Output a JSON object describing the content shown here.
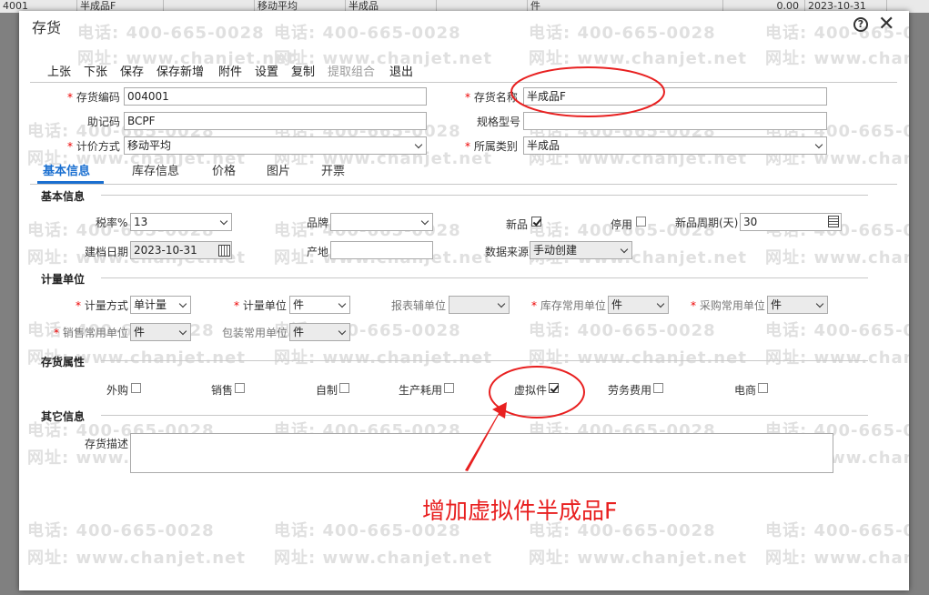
{
  "background_row": {
    "cells": [
      "4001",
      "半成品F",
      "移动平均",
      "半成品",
      "件",
      "0.00",
      "2023-10-31"
    ]
  },
  "dialog": {
    "title": "存货",
    "help_glyph": "?",
    "close_glyph": "✕"
  },
  "watermark": {
    "phone": "电话: 400-665-0028",
    "site": "网址: www.chanjet.net"
  },
  "toolbar": {
    "prev": "上张",
    "next": "下张",
    "save": "保存",
    "save_new": "保存新增",
    "attach": "附件",
    "settings": "设置",
    "copy": "复制",
    "extract_combo": "提取组合",
    "exit": "退出"
  },
  "header_form": {
    "code_label": "存货编码",
    "code_value": "004001",
    "name_label": "存货名称",
    "name_value": "半成品F",
    "mnemonic_label": "助记码",
    "mnemonic_value": "BCPF",
    "spec_label": "规格型号",
    "spec_value": "",
    "pricing_label": "计价方式",
    "pricing_value": "移动平均",
    "category_label": "所属类别",
    "category_value": "半成品"
  },
  "tabs": [
    "基本信息",
    "库存信息",
    "价格",
    "图片",
    "开票"
  ],
  "basic": {
    "section_title": "基本信息",
    "tax_label": "税率%",
    "tax_value": "13",
    "brand_label": "品牌",
    "brand_value": "",
    "new_label": "新品",
    "new_checked": true,
    "disabled_label": "停用",
    "disabled_checked": false,
    "new_period_label": "新品周期(天)",
    "new_period_value": "30",
    "created_label": "建档日期",
    "created_value": "2023-10-31",
    "origin_label": "产地",
    "origin_value": "",
    "source_label": "数据来源",
    "source_value": "手动创建"
  },
  "units": {
    "section_title": "计量单位",
    "method_label": "计量方式",
    "method_value": "单计量",
    "unit_label": "计量单位",
    "unit_value": "件",
    "report_label": "报表辅单位",
    "report_value": "",
    "stock_label": "库存常用单位",
    "stock_value": "件",
    "purchase_label": "采购常用单位",
    "purchase_value": "件",
    "sales_label": "销售常用单位",
    "sales_value": "件",
    "pack_label": "包装常用单位",
    "pack_value": "件"
  },
  "attributes": {
    "section_title": "存货属性",
    "items": [
      {
        "label": "外购",
        "checked": false
      },
      {
        "label": "销售",
        "checked": false
      },
      {
        "label": "自制",
        "checked": false
      },
      {
        "label": "生产耗用",
        "checked": false
      },
      {
        "label": "虚拟件",
        "checked": true
      },
      {
        "label": "劳务费用",
        "checked": false
      },
      {
        "label": "电商",
        "checked": false
      }
    ]
  },
  "other": {
    "section_title": "其它信息",
    "desc_label": "存货描述",
    "desc_value": ""
  },
  "annotation": {
    "text": "增加虚拟件半成品F",
    "color": "#e82020"
  }
}
